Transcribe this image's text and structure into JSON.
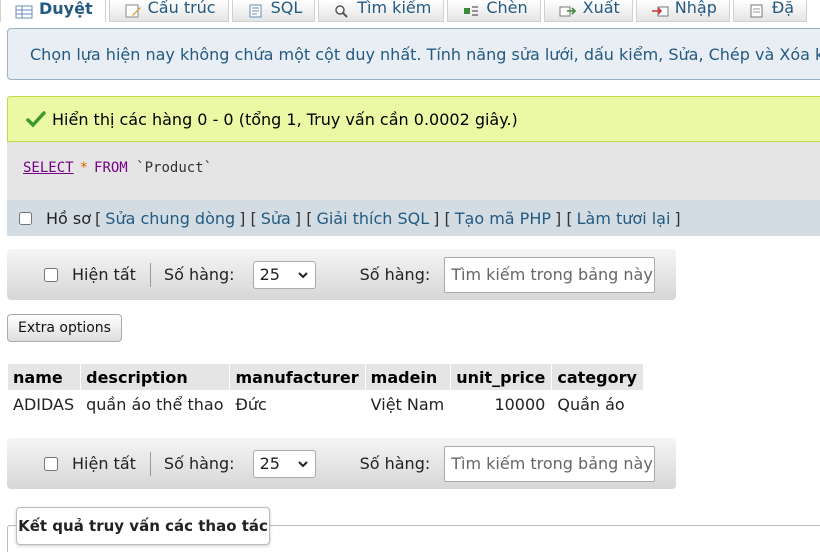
{
  "tabs": [
    {
      "label": "Duyệt",
      "icon": "browse-icon",
      "active": true
    },
    {
      "label": "Cấu trúc",
      "icon": "structure-icon",
      "active": false
    },
    {
      "label": "SQL",
      "icon": "sql-icon",
      "active": false
    },
    {
      "label": "Tìm kiếm",
      "icon": "search-icon",
      "active": false
    },
    {
      "label": "Chèn",
      "icon": "insert-icon",
      "active": false
    },
    {
      "label": "Xuất",
      "icon": "export-icon",
      "active": false
    },
    {
      "label": "Nhập",
      "icon": "import-icon",
      "active": false
    },
    {
      "label": "Đặ",
      "icon": "privileges-icon",
      "active": false
    }
  ],
  "warning": {
    "text": "Chọn lựa hiện nay không chứa một cột duy nhất. Tính năng sửa lưới, dấu kiểm, Sửa, Chép và Xóa không",
    "icon": "warning-icon"
  },
  "success": {
    "text": "Hiển thị các hàng 0 - 0 (tổng 1, Truy vấn cần 0.0002 giây.)",
    "icon": "check-icon"
  },
  "sql": {
    "select": "SELECT",
    "star": "*",
    "from": "FROM",
    "table": "`Product`"
  },
  "profile": {
    "label": "Hồ sơ",
    "links": [
      "Sửa chung dòng",
      "Sửa",
      "Giải thích SQL",
      "Tạo mã PHP",
      "Làm tươi lại"
    ]
  },
  "navbar": {
    "show_all": "Hiện tất",
    "rows_label": "Số hàng:",
    "rows_value": "25",
    "filter_label": "Số hàng:",
    "search_placeholder": "Tìm kiếm trong bảng này"
  },
  "extra_options": "Extra options",
  "table": {
    "columns": [
      "name",
      "description",
      "manufacturer",
      "madein",
      "unit_price",
      "category"
    ],
    "rows": [
      [
        "ADIDAS",
        "quần áo thể thao",
        "Đức",
        "Việt Nam",
        "10000",
        "Quần áo"
      ]
    ]
  },
  "results_tab": "Kết quả truy vấn các thao tác",
  "colors": {
    "link": "#235a81",
    "success_bg": "#ebf8a4",
    "warning_bg": "#e9eef4",
    "keyword": "#770088"
  }
}
